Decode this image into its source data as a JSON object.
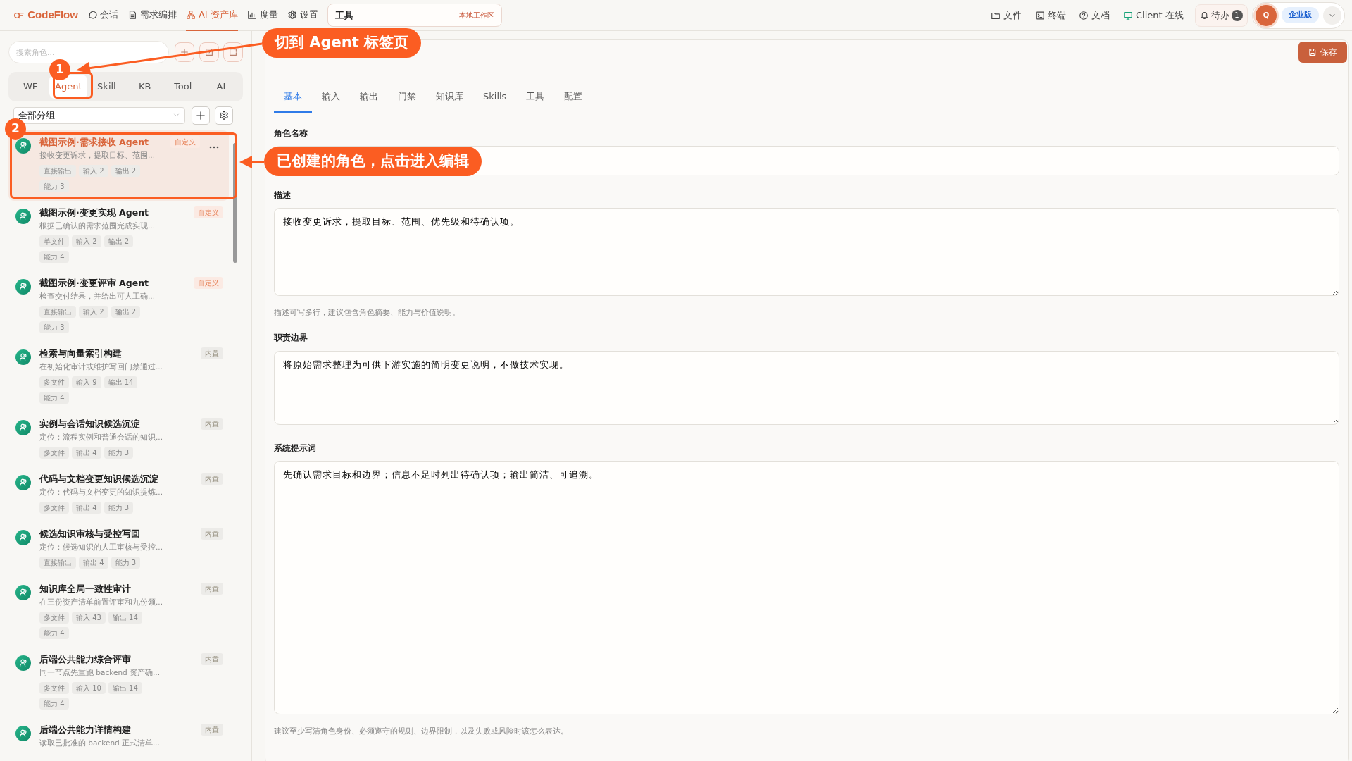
{
  "topbar": {
    "logo": "CodeFlow",
    "nav": [
      {
        "label": "会话",
        "selected": false
      },
      {
        "label": "需求编排",
        "selected": false
      },
      {
        "label": "AI 资产库",
        "selected": true
      },
      {
        "label": "度量",
        "selected": false
      },
      {
        "label": "设置",
        "selected": false
      }
    ],
    "workspace": {
      "value": "工具",
      "tag": "本地工作区"
    },
    "actions": [
      {
        "label": "文件"
      },
      {
        "label": "终端"
      },
      {
        "label": "文档"
      },
      {
        "label": "Client 在线"
      }
    ],
    "todo": {
      "label": "待办",
      "count": "1"
    },
    "avatar": "Q",
    "plan": "企业版"
  },
  "sidebar": {
    "search_placeholder": "搜索角色...",
    "tabs": [
      {
        "label": "WF",
        "selected": false
      },
      {
        "label": "Agent",
        "selected": true
      },
      {
        "label": "Skill",
        "selected": false
      },
      {
        "label": "KB",
        "selected": false
      },
      {
        "label": "Tool",
        "selected": false
      },
      {
        "label": "AI",
        "selected": false
      }
    ],
    "group": "全部分组",
    "items": [
      {
        "title": "截图示例·需求接收 Agent",
        "description": "接收变更诉求，提取目标、范围...",
        "badge": "自定义",
        "color": "#fbeae3",
        "tags": [
          "直接输出",
          "输入 2",
          "输出 2",
          "能力 3"
        ],
        "selected": true
      },
      {
        "title": "截图示例·变更实现 Agent",
        "description": "根据已确认的需求范围完成实现...",
        "badge": "自定义",
        "color": "#fbeae3",
        "tags": [
          "单文件",
          "输入 2",
          "输出 2",
          "能力 4"
        ],
        "selected": false
      },
      {
        "title": "截图示例·变更评审 Agent",
        "description": "检查交付结果，并给出可人工确...",
        "badge": "自定义",
        "color": "#fbeae3",
        "tags": [
          "直接输出",
          "输入 2",
          "输出 2",
          "能力 3"
        ],
        "selected": false
      },
      {
        "title": "检索与向量索引构建",
        "description": "在初始化审计或维护写回门禁通过...",
        "badge": "内置",
        "color": "#ecebe8",
        "tags": [
          "多文件",
          "输入 9",
          "输出 14",
          "能力 4"
        ],
        "selected": false
      },
      {
        "title": "实例与会话知识候选沉淀",
        "description": "定位：流程实例和普通会话的知识...",
        "badge": "内置",
        "color": "#ecebe8",
        "tags": [
          "多文件",
          "输出 4",
          "能力 3"
        ],
        "selected": false
      },
      {
        "title": "代码与文档变更知识候选沉淀",
        "description": "定位：代码与文档变更的知识提炼...",
        "badge": "内置",
        "color": "#ecebe8",
        "tags": [
          "多文件",
          "输出 4",
          "能力 3"
        ],
        "selected": false
      },
      {
        "title": "候选知识审核与受控写回",
        "description": "定位：候选知识的人工审核与受控...",
        "badge": "内置",
        "color": "#ecebe8",
        "tags": [
          "直接输出",
          "输出 4",
          "能力 3"
        ],
        "selected": false
      },
      {
        "title": "知识库全局一致性审计",
        "description": "在三份资产清单前置评审和九份领...",
        "badge": "内置",
        "color": "#ecebe8",
        "tags": [
          "多文件",
          "输入 43",
          "输出 14",
          "能力 4"
        ],
        "selected": false
      },
      {
        "title": "后端公共能力综合评审",
        "description": "同一节点先重跑 backend 资产确...",
        "badge": "内置",
        "color": "#ecebe8",
        "tags": [
          "多文件",
          "输入 10",
          "输出 14",
          "能力 4"
        ],
        "selected": false
      },
      {
        "title": "后端公共能力详情构建",
        "description": "读取已批准的 backend 正式清单...",
        "badge": "内置",
        "color": "#ecebe8",
        "selected": false
      }
    ]
  },
  "editor": {
    "save": "保存",
    "tabs": [
      {
        "label": "基本",
        "selected": true
      },
      {
        "label": "输入",
        "selected": false
      },
      {
        "label": "输出",
        "selected": false
      },
      {
        "label": "门禁",
        "selected": false
      },
      {
        "label": "知识库",
        "selected": false
      },
      {
        "label": "Skills",
        "selected": false
      },
      {
        "label": "工具",
        "selected": false
      },
      {
        "label": "配置",
        "selected": false
      }
    ],
    "fields": [
      {
        "kind": "input",
        "label": "角色名称"
      },
      {
        "kind": "textarea",
        "label": "描述",
        "value": "接收变更诉求，提取目标、范围、优先级和待确认项。",
        "hint": "描述可写多行，建议包含角色摘要、能力与价值说明。"
      },
      {
        "kind": "textarea",
        "label": "职责边界",
        "value": "将原始需求整理为可供下游实施的简明变更说明，不做技术实现。"
      },
      {
        "kind": "textarea",
        "label": "系统提示词",
        "value": "先确认需求目标和边界；信息不足时列出待确认项；输出简洁、可追溯。",
        "hint": "建议至少写清角色身份、必须遵守的规则、边界限制，以及失败或风险时该怎么表达。"
      }
    ]
  },
  "annotations": [
    {
      "number": "1",
      "text": "切到 Agent 标签页"
    },
    {
      "number": "2",
      "text": "已创建的角色，点击进入编辑"
    }
  ]
}
